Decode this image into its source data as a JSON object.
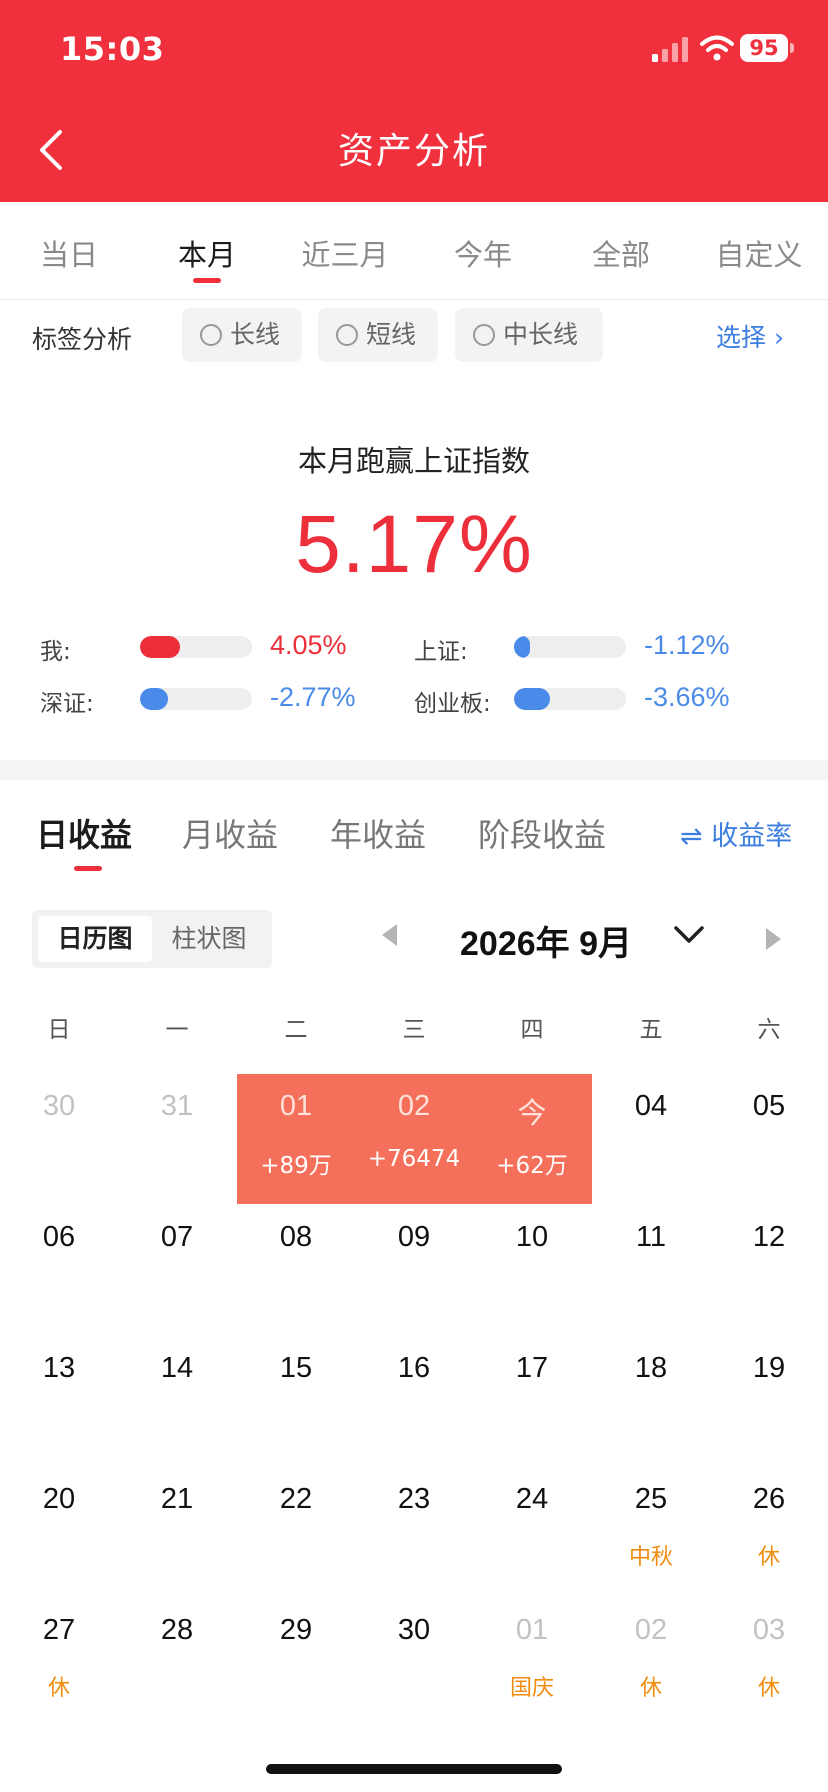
{
  "status_bar": {
    "time": "15:03",
    "battery": "95"
  },
  "header": {
    "title": "资产分析"
  },
  "period_tabs": [
    "当日",
    "本月",
    "近三月",
    "今年",
    "全部",
    "自定义"
  ],
  "period_active": "本月",
  "tag_filter": {
    "label": "标签分析",
    "chips": [
      "长线",
      "短线",
      "中长线"
    ],
    "select_label": "选择 ›"
  },
  "beat": {
    "title": "本月跑赢上证指数",
    "value": "5.17%",
    "compare": [
      {
        "label": "我:",
        "value": "4.05%",
        "fraction": 0.36,
        "color": "#ec2f3b"
      },
      {
        "label": "上证:",
        "value": "-1.12%",
        "fraction": 0.1,
        "color": "#4a8ae8"
      },
      {
        "label": "深证:",
        "value": "-2.77%",
        "fraction": 0.25,
        "color": "#4a8ae8"
      },
      {
        "label": "创业板:",
        "value": "-3.66%",
        "fraction": 0.32,
        "color": "#4a8ae8"
      }
    ]
  },
  "earnings_tabs": [
    "日收益",
    "月收益",
    "年收益",
    "阶段收益"
  ],
  "rate_toggle": "⇌ 收益率",
  "view_toggle": [
    "日历图",
    "柱状图"
  ],
  "month_label": "2026年 9月",
  "weekdays": [
    "日",
    "一",
    "二",
    "三",
    "四",
    "五",
    "六"
  ],
  "calendar_rows": [
    [
      {
        "d": "30",
        "muted": true
      },
      {
        "d": "31",
        "muted": true
      },
      {
        "d": "01",
        "sub": "+89万",
        "hl": true
      },
      {
        "d": "02",
        "sub": "+76474",
        "hl": true
      },
      {
        "d": "今",
        "sub": "+62万",
        "hl": true
      },
      {
        "d": "04"
      },
      {
        "d": "05"
      }
    ],
    [
      {
        "d": "06"
      },
      {
        "d": "07"
      },
      {
        "d": "08"
      },
      {
        "d": "09"
      },
      {
        "d": "10"
      },
      {
        "d": "11"
      },
      {
        "d": "12"
      }
    ],
    [
      {
        "d": "13"
      },
      {
        "d": "14"
      },
      {
        "d": "15"
      },
      {
        "d": "16"
      },
      {
        "d": "17"
      },
      {
        "d": "18"
      },
      {
        "d": "19"
      }
    ],
    [
      {
        "d": "20"
      },
      {
        "d": "21"
      },
      {
        "d": "22"
      },
      {
        "d": "23"
      },
      {
        "d": "24"
      },
      {
        "d": "25",
        "sub": "中秋"
      },
      {
        "d": "26",
        "sub": "休"
      }
    ],
    [
      {
        "d": "27",
        "sub": "休"
      },
      {
        "d": "28"
      },
      {
        "d": "29"
      },
      {
        "d": "30"
      },
      {
        "d": "01",
        "muted": true,
        "sub": "国庆"
      },
      {
        "d": "02",
        "muted": true,
        "sub": "休"
      },
      {
        "d": "03",
        "muted": true,
        "sub": "休"
      }
    ]
  ]
}
